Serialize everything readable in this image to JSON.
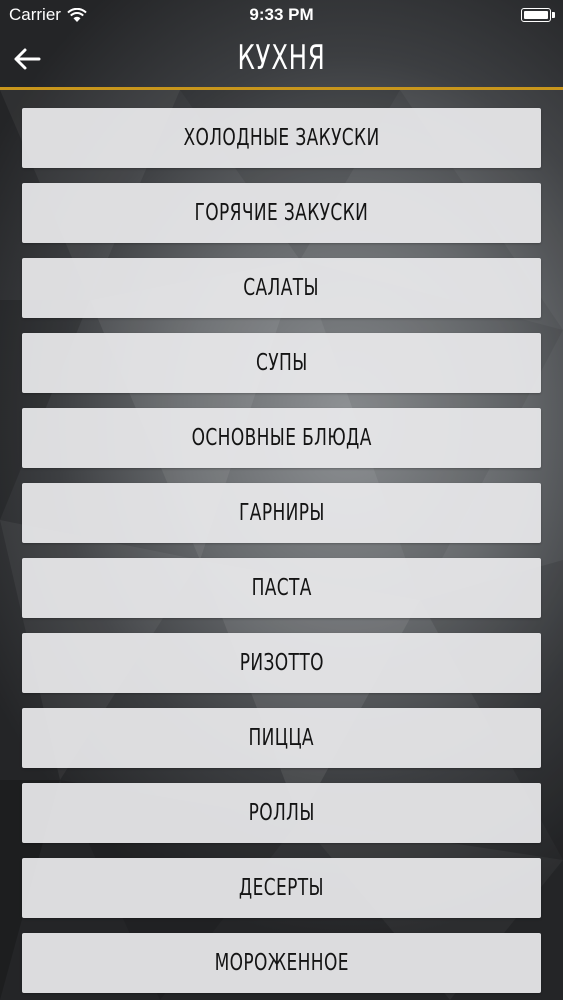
{
  "status_bar": {
    "carrier": "Carrier",
    "time": "9:33 PM",
    "wifi_icon": "wifi-icon",
    "battery_icon": "battery-icon"
  },
  "nav": {
    "title": "КУХНЯ",
    "back_icon": "arrow-left-icon",
    "accent_color": "#c8961c"
  },
  "menu": {
    "items": [
      {
        "label": "ХОЛОДНЫЕ ЗАКУСКИ"
      },
      {
        "label": "ГОРЯЧИЕ ЗАКУСКИ"
      },
      {
        "label": "САЛАТЫ"
      },
      {
        "label": "СУПЫ"
      },
      {
        "label": "ОСНОВНЫЕ БЛЮДА"
      },
      {
        "label": "ГАРНИРЫ"
      },
      {
        "label": "ПАСТА"
      },
      {
        "label": "РИЗОТТО"
      },
      {
        "label": "ПИЦЦА"
      },
      {
        "label": "РОЛЛЫ"
      },
      {
        "label": "ДЕСЕРТЫ"
      },
      {
        "label": "МОРОЖЕННОЕ"
      }
    ]
  }
}
